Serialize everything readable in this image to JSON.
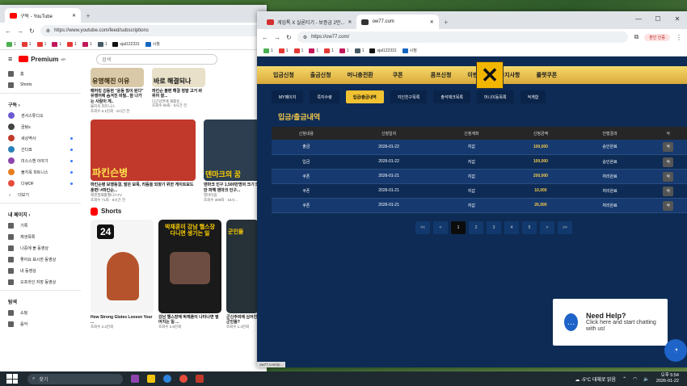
{
  "left": {
    "tab_title": "구독 - YouTube",
    "url": "https://www.youtube.com/feed/subscriptions",
    "bookmarks": [
      "1",
      "1",
      "1",
      "1",
      "1",
      "1",
      "1",
      "sjal122331",
      "시청"
    ],
    "logo": "Premium",
    "logo_sup": "KR",
    "search_placeholder": "검색",
    "side_top": [
      {
        "label": "홈"
      },
      {
        "label": "Shorts"
      }
    ],
    "sub_header": "구독",
    "subs": [
      {
        "label": "센서스튜디오",
        "color": "#6b5bd2"
      },
      {
        "label": "곰탕s",
        "color": "#444"
      },
      {
        "label": "세상역사",
        "color": "#c0392b"
      },
      {
        "label": "간다죠",
        "color": "#2980b9"
      },
      {
        "label": "미스스헨 이야기",
        "color": "#8e44ad"
      },
      {
        "label": "불지옥 피트니스",
        "color": "#e67e22"
      },
      {
        "label": "다큐DF",
        "color": "#e74c3c"
      },
      {
        "label": "더보기",
        "color": ""
      }
    ],
    "my_header": "내 페이지",
    "my_items": [
      {
        "label": "기록"
      },
      {
        "label": "재생목록"
      },
      {
        "label": "나중에 볼 동영상"
      },
      {
        "label": "좋아요 표시한 동영상"
      },
      {
        "label": "내 동영상"
      },
      {
        "label": "오프라인 저장 동영상"
      }
    ],
    "explore_header": "탐색",
    "explore_items": [
      {
        "label": "쇼핑"
      },
      {
        "label": "음악"
      }
    ],
    "row1": [
      {
        "thumb_text": "유명해진 이유",
        "title": "패러킹 김동현 \"운동 많이 된다\" 유행어에 숨겨진 비밀.. 참 나가는 사람이 게..",
        "meta1": "불지옥 피트니스",
        "meta2": "조회수 5.1만회 · 8시간 전",
        "color": "#d9c9a8"
      },
      {
        "thumb_text": "바로 해결되나",
        "title": "파킨슨 불편 해결 정말 고거 바위어 잘...",
        "meta1": "디곤강연에 재활운...",
        "meta2": "조회수 66회 · 5시간 전",
        "color": "#e8e0c8"
      }
    ],
    "row2": [
      {
        "thumb_text": "파킨슨병",
        "title": "파킨슨병 보행동결, 발은 보폭, 리듬을 되찾기 위한 게이트보드 훈련! #파킨슨...",
        "meta1": "헤겐필재활웰니스TV",
        "meta2": "조회수 71회 · 8시간 전",
        "color": "#c0392b"
      },
      {
        "thumb_text": "덴마크의 꿈",
        "title": "덴마크 인구 1,500만명의 크기 5만 파헤 덴마크 인구...",
        "meta1": "열바이봄",
        "meta2": "조회수 309회 · 16시...",
        "color": "#2c3e50"
      }
    ],
    "shorts_header": "Shorts",
    "shorts": [
      {
        "title": "How Strong Glutes Loosen Your ...",
        "meta": "조회수 2.2만회",
        "color": "#f5f5f5",
        "thumb_text": "24"
      },
      {
        "title": "강남 헬스장에 박재훈이 나타나면 벌어지는 일 ...",
        "meta": "조회수 2.5만회",
        "color": "#1a1a1a",
        "thumb_text": "박재훈이 강남 헬스장 다니면 생기는 일"
      },
      {
        "title": "군신주의에 심어진 군인들?",
        "meta": "조회수 1.4만회",
        "color": "#263238",
        "thumb_text": "군인들"
      }
    ]
  },
  "right": {
    "tabs": [
      "게임톡 X 실론티기 - 보증금 2만...",
      "ow77.com"
    ],
    "url": "https://ow77.com/",
    "bookmarks": [
      "1",
      "1",
      "1",
      "1",
      "1",
      "1",
      "1",
      "sjal122331",
      "시청"
    ],
    "profile_btn": "본인 인증",
    "nav": [
      "입금신청",
      "출금신청",
      "머니충전환",
      "쿠폰",
      "콤프신청",
      "이벤트",
      "공지사항",
      "룰렛쿠폰"
    ],
    "subtabs": [
      "MY페이지",
      "쪽지수령",
      "입금/출금내역",
      "지인친구목록",
      "출석체크목록",
      "머니이동목록",
      "적게함"
    ],
    "active_subtab": 2,
    "section_title": "입금/출금내역",
    "table_headers": [
      "신청내용",
      "신청일자",
      "신청계좌",
      "신청금액",
      "진행결과",
      "삭"
    ],
    "rows": [
      {
        "type": "출금",
        "date": "2026-01-22",
        "acct": "지갑",
        "amount": "100,000",
        "result": "승인완료",
        "del": "삭"
      },
      {
        "type": "입금",
        "date": "2026-01-22",
        "acct": "지갑",
        "amount": "100,000",
        "result": "승인완료",
        "del": "삭"
      },
      {
        "type": "쿠폰",
        "date": "2026-01-21",
        "acct": "지갑",
        "amount": "200,000",
        "result": "처리완료",
        "del": "삭"
      },
      {
        "type": "쿠폰",
        "date": "2026-01-21",
        "acct": "지갑",
        "amount": "10,000",
        "result": "처리완료",
        "del": "삭"
      },
      {
        "type": "쿠폰",
        "date": "2026-01-21",
        "acct": "지갑",
        "amount": "26,000",
        "result": "처리완료",
        "del": "삭"
      }
    ],
    "pager": [
      "<<",
      "<",
      "1",
      "2",
      "3",
      "4",
      "5",
      ">",
      ">>"
    ],
    "help_title": "Need Help?",
    "help_sub": "Click here and start chatting with us!",
    "status_url": "ow77.com/js..."
  },
  "taskbar": {
    "search": "찾기",
    "weather": "-5°C  대체로 맑음",
    "time": "오후 5:54",
    "date": "2026-01-22"
  },
  "colors": {
    "accent_gold": "#f4c94a",
    "site_bg": "#0d2b55",
    "yt_red": "#ff0000"
  }
}
